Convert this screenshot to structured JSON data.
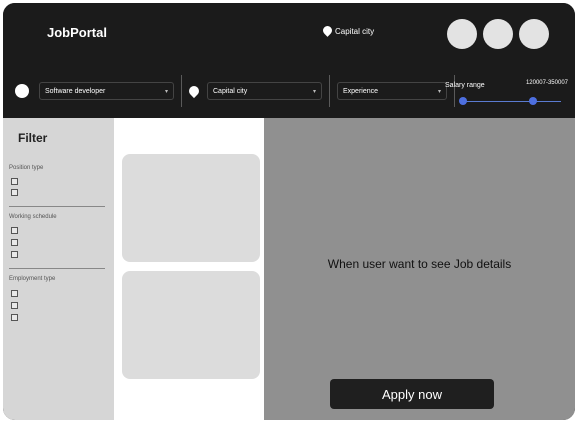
{
  "header": {
    "logo": "JobPortal",
    "location": "Capital city",
    "avatar_count": 3
  },
  "search": {
    "position": "Software developer",
    "location": "Capital city",
    "experience": "Experience",
    "salary_label": "Salary range",
    "salary_range": "120007-350007"
  },
  "filter": {
    "title": "Filter",
    "groups": [
      {
        "label": "Position type",
        "checkbox_count": 2
      },
      {
        "label": "Working schedule",
        "checkbox_count": 3
      },
      {
        "label": "Employment type",
        "checkbox_count": 3
      }
    ]
  },
  "details": {
    "message": "When user want to see Job details",
    "apply_label": "Apply now"
  },
  "colors": {
    "topbar": "#1b1b1b",
    "filter_bg": "#d6d6d6",
    "details_bg": "#909090",
    "slider": "#4d6fe0"
  }
}
